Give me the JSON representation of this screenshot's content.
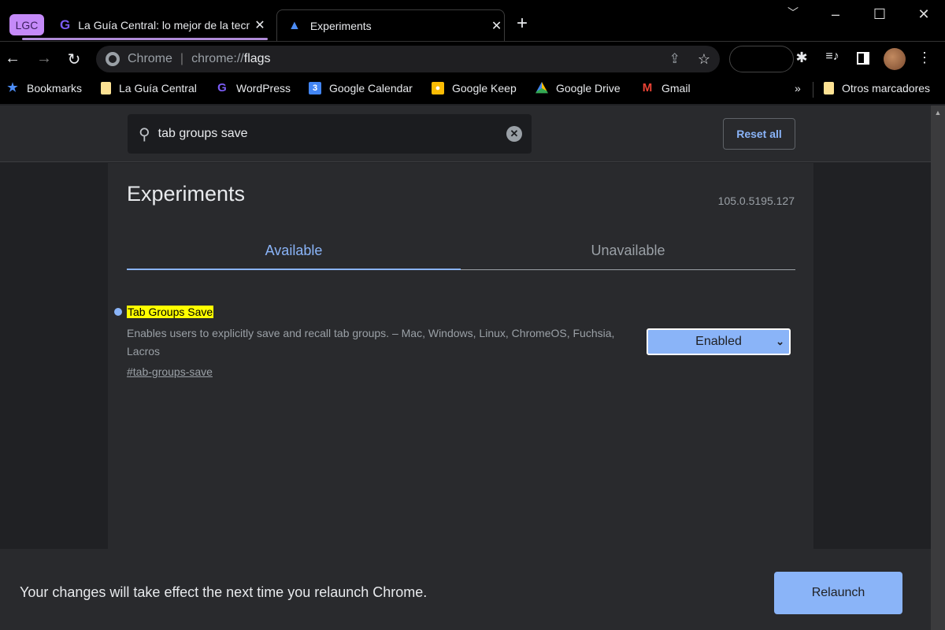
{
  "browser": {
    "tab_group_label": "LGC",
    "tabs": [
      {
        "title": "La Guía Central: lo mejor de la tecnología",
        "favicon": "lgc-logo-icon"
      },
      {
        "title": "Experiments",
        "favicon": "flask-icon",
        "active": true
      }
    ],
    "new_tab": "+",
    "omnibox": {
      "scheme_label": "Chrome",
      "url_prefix": "chrome://",
      "url_host": "flags"
    },
    "bookmarks": [
      {
        "label": "Bookmarks",
        "icon": "star-icon"
      },
      {
        "label": "La Guía Central",
        "icon": "folder-icon"
      },
      {
        "label": "WordPress",
        "icon": "lgc-logo-icon"
      },
      {
        "label": "Google Calendar",
        "icon": "calendar-icon"
      },
      {
        "label": "Google Keep",
        "icon": "keep-icon"
      },
      {
        "label": "Google Drive",
        "icon": "drive-icon"
      },
      {
        "label": "Gmail",
        "icon": "gmail-icon"
      }
    ],
    "overflow": "»",
    "other_bookmarks": "Otros marcadores"
  },
  "flags": {
    "search_value": "tab groups save",
    "reset_all": "Reset all",
    "title": "Experiments",
    "version": "105.0.5195.127",
    "tabs": [
      {
        "label": "Available",
        "active": true
      },
      {
        "label": "Unavailable"
      }
    ],
    "experiment": {
      "name": "Tab Groups Save",
      "description": "Enables users to explicitly save and recall tab groups. – Mac, Windows, Linux, ChromeOS, Fuchsia, Lacros",
      "link": "#tab-groups-save",
      "selected": "Enabled"
    },
    "footer_message": "Your changes will take effect the next time you relaunch Chrome.",
    "relaunch": "Relaunch"
  },
  "colors": {
    "accent": "#8ab4f8",
    "highlight": "#ffff00",
    "tab_group": "#c58af9"
  }
}
